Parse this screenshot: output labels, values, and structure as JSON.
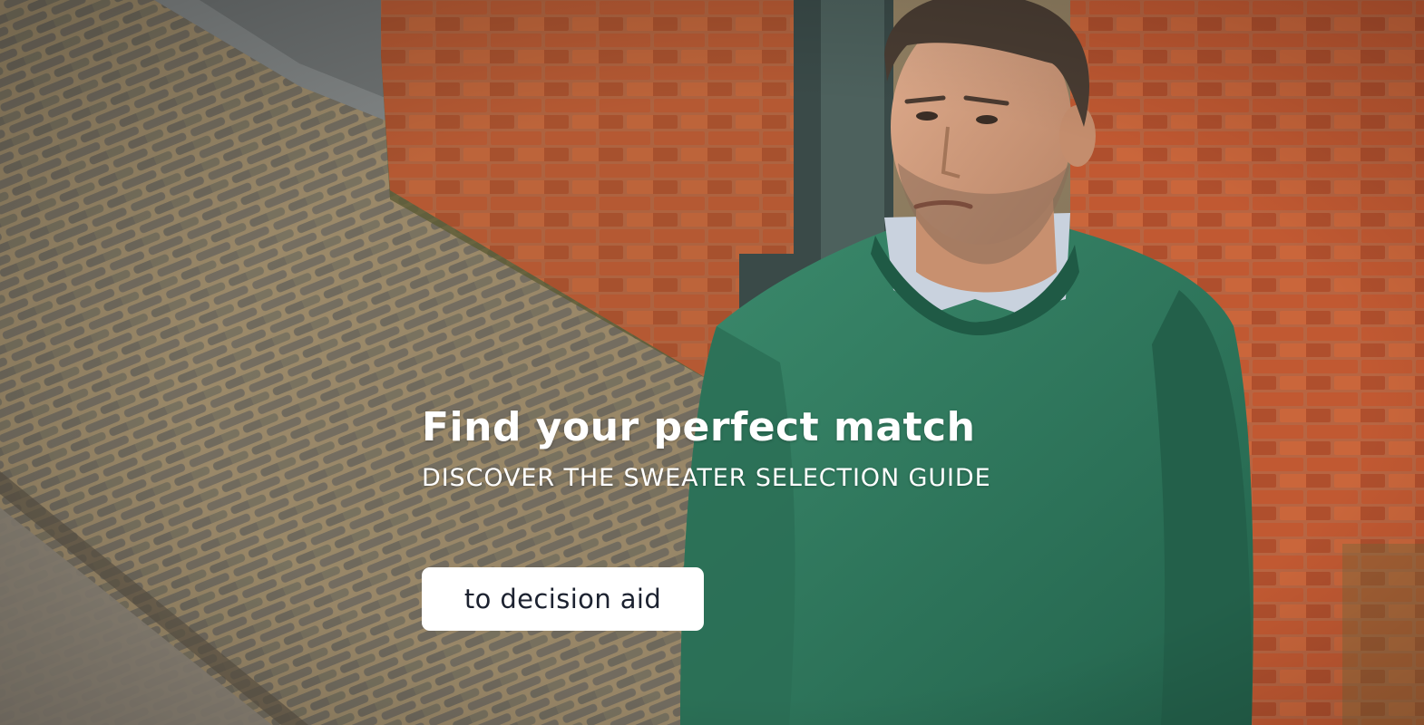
{
  "hero": {
    "image_description": "man-in-green-sweater-in-front-of-brick-wall",
    "headline": "Find your perfect match",
    "subheadline": "DISCOVER THE SWEATER SELECTION GUIDE",
    "cta_label": "to decision aid"
  },
  "colors": {
    "headline_text": "#ffffff",
    "button_background": "#ffffff",
    "button_text": "#1c2230",
    "sweater_green": "#2f7a5e",
    "brick": "#b8542f"
  }
}
